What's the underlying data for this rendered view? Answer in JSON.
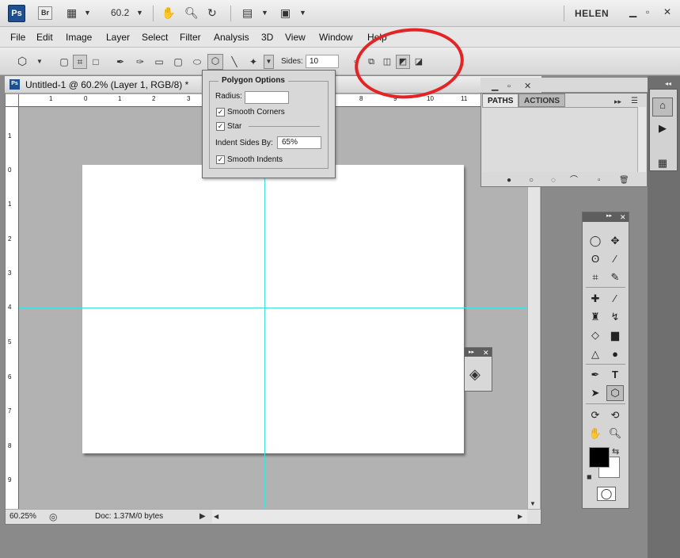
{
  "appbar": {
    "ps_logo": "Ps",
    "br_logo": "Br",
    "zoom_value": "60.2",
    "user": "HELEN",
    "icons": [
      "launch-bridge-icon",
      "view-extras-icon",
      "zoom-level-dropdown",
      "hand-icon",
      "zoom-icon",
      "rotate-view-icon",
      "arrange-documents-icon",
      "screen-mode-icon"
    ],
    "window_controls": [
      "minimize",
      "restore",
      "close"
    ]
  },
  "menu": {
    "items": [
      "File",
      "Edit",
      "Image",
      "Layer",
      "Select",
      "Filter",
      "Analysis",
      "3D",
      "View",
      "Window",
      "Help"
    ]
  },
  "options_bar": {
    "sides_label": "Sides:",
    "sides_value": "10"
  },
  "polygon_options": {
    "title": "Polygon Options",
    "radius_label": "Radius:",
    "radius_value": "",
    "smooth_corners_label": "Smooth Corners",
    "smooth_corners_checked": true,
    "star_label": "Star",
    "star_checked": true,
    "indent_label": "Indent Sides By:",
    "indent_value": "65%",
    "smooth_indents_label": "Smooth Indents",
    "smooth_indents_checked": true
  },
  "document": {
    "title": "Untitled-1 @ 60.2% (Layer 1, RGB/8) *",
    "zoom_status": "60.25%",
    "doc_info": "Doc: 1.37M/0 bytes",
    "h_ruler_labels": [
      "1",
      "0",
      "1",
      "2",
      "3",
      "8",
      "9",
      "10",
      "11"
    ],
    "v_ruler_labels": [
      "1",
      "0",
      "1",
      "2",
      "3",
      "4",
      "5",
      "6",
      "7",
      "8",
      "9"
    ]
  },
  "paths_panel": {
    "tabs": [
      "PATHS",
      "ACTIONS"
    ],
    "active_tab": "PATHS"
  },
  "colors": {
    "guide": "#3fe3e3",
    "annotation": "#e52224",
    "foreground": "#000000",
    "background": "#ffffff"
  }
}
